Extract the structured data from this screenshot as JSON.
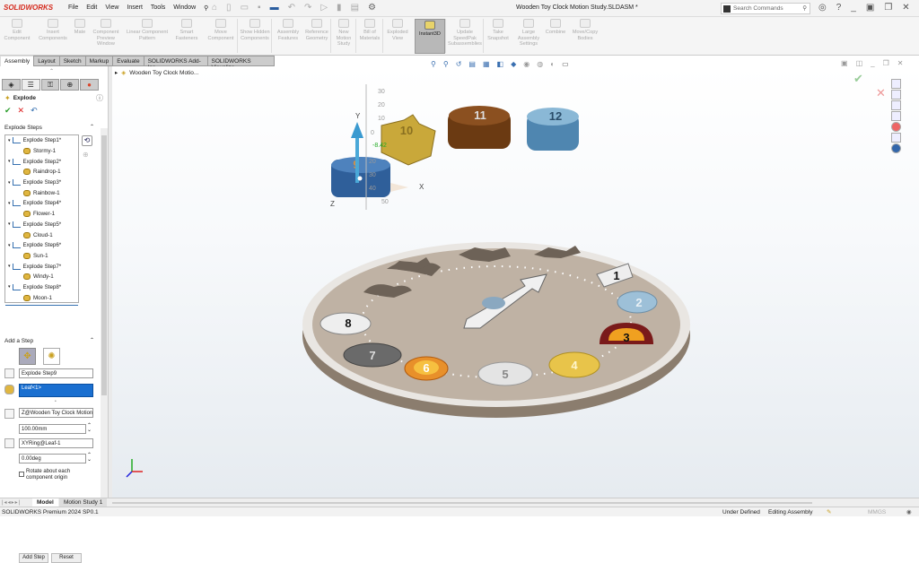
{
  "app": {
    "logo": "SOLIDWORKS",
    "title": "Wooden Toy Clock Motion Study.SLDASM *"
  },
  "menu": [
    "File",
    "Edit",
    "View",
    "Insert",
    "Tools",
    "Window"
  ],
  "search": {
    "placeholder": "Search Commands"
  },
  "ribbon": [
    {
      "label": "Edit Component"
    },
    {
      "label": "Insert Components"
    },
    {
      "label": "Mate"
    },
    {
      "label": "Component Preview Window"
    },
    {
      "label": "Linear Component Pattern"
    },
    {
      "label": "Smart Fasteners"
    },
    {
      "label": "Move Component"
    },
    {
      "label": "Show Hidden Components"
    },
    {
      "label": "Assembly Features"
    },
    {
      "label": "Reference Geometry"
    },
    {
      "label": "New Motion Study"
    },
    {
      "label": "Bill of Materials"
    },
    {
      "label": "Exploded View"
    },
    {
      "label": "Instant3D"
    },
    {
      "label": "Update SpeedPak Subassemblies"
    },
    {
      "label": "Take Snapshot"
    },
    {
      "label": "Large Assembly Settings"
    },
    {
      "label": "Combine"
    },
    {
      "label": "Move/Copy Bodies"
    }
  ],
  "tabs": [
    "Assembly",
    "Layout",
    "Sketch",
    "Markup",
    "Evaluate",
    "SOLIDWORKS Add-Ins",
    "SOLIDWORKS Visualize"
  ],
  "panel": {
    "title": "Explode",
    "steps_header": "Explode Steps",
    "steps": [
      {
        "step": "Explode Step1*",
        "component": "Stormy-1"
      },
      {
        "step": "Explode Step2*",
        "component": "Raindrop-1"
      },
      {
        "step": "Explode Step3*",
        "component": "Rainbow-1"
      },
      {
        "step": "Explode Step4*",
        "component": "Flower-1"
      },
      {
        "step": "Explode Step5*",
        "component": "Cloud-1"
      },
      {
        "step": "Explode Step6*",
        "component": "Sun-1"
      },
      {
        "step": "Explode Step7*",
        "component": "Windy-1"
      },
      {
        "step": "Explode Step8*",
        "component": "Moon-1"
      }
    ],
    "add_step_header": "Add a Step",
    "step_name": "Explode Step9",
    "selected_component": "Leaf<1>",
    "direction": "Z@Wooden Toy Clock Motion",
    "distance": "100.00mm",
    "rotation_axis": "XYRing@Leaf-1",
    "angle": "0.00deg",
    "rotate_checkbox": "Rotate about each component origin",
    "rotate_checked": false,
    "add_step_button": "Add Step",
    "reset_button": "Reset"
  },
  "tree_root": "Wooden Toy Clock Motio...",
  "viewport": {
    "ruler_labels": [
      "30",
      "20",
      "10",
      "0",
      "-8.42",
      "20",
      "30",
      "40",
      "50"
    ],
    "axes": [
      "Y",
      "X",
      "Z"
    ],
    "part_numbers": [
      "1",
      "2",
      "3",
      "4",
      "5",
      "6",
      "7",
      "8",
      "9",
      "10",
      "11",
      "12"
    ]
  },
  "bottom_tabs": [
    "Model",
    "Motion Study 1"
  ],
  "status": {
    "version": "SOLIDWORKS Premium 2024 SP0.1",
    "state": "Under Defined",
    "mode": "Editing Assembly",
    "units": "MMGS"
  }
}
